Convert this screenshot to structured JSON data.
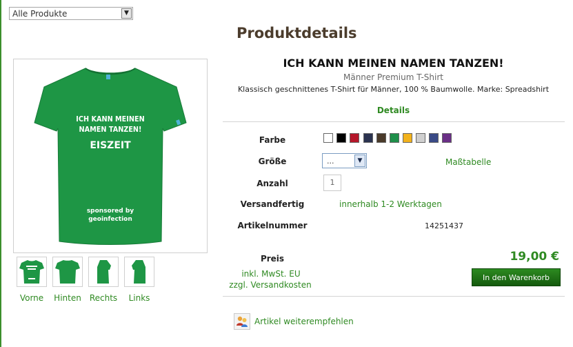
{
  "category_select": {
    "value": "Alle Produkte"
  },
  "page_title": "Produktdetails",
  "product": {
    "title": "ICH KANN MEINEN NAMEN TANZEN!",
    "subtitle": "Männer Premium T-Shirt",
    "description": "Klassisch geschnittenes T-Shirt für Männer, 100 % Baumwolle. Marke: Spreadshirt",
    "shirt_print": {
      "line1": "ICH KANN MEINEN",
      "line2": "NAMEN TANZEN!",
      "line3": "EISZEIT",
      "line4": "sponsored by",
      "line5": "geoinfection"
    }
  },
  "thumbnails": [
    {
      "label": "Vorne"
    },
    {
      "label": "Hinten"
    },
    {
      "label": "Rechts"
    },
    {
      "label": "Links"
    }
  ],
  "details_tab": "Details",
  "attributes": {
    "color_label": "Farbe",
    "colors": [
      "#ffffff",
      "#000000",
      "#b5172a",
      "#2b3350",
      "#4a3a2a",
      "#1f8f4a",
      "#f2b21c",
      "#cfcfcf",
      "#3a4a86",
      "#6a2f86"
    ],
    "size_label": "Größe",
    "size_value": "...",
    "size_chart_link": "Maßtabelle",
    "quantity_label": "Anzahl",
    "quantity_value": "1",
    "shipping_label": "Versandfertig",
    "shipping_value": "innerhalb 1-2 Werktagen",
    "article_label": "Artikelnummer",
    "article_value": "14251437"
  },
  "pricing": {
    "price_label": "Preis",
    "tax_note": "inkl. MwSt. EU",
    "shipping_note": "zzgl. Versandkosten",
    "price": "19,00 €",
    "cart_button": "In den Warenkorb"
  },
  "recommend": {
    "label": "Artikel weiterempfehlen",
    "icon": "people-icon"
  },
  "colors": {
    "accent": "#2f8a22",
    "shirt": "#1e9645",
    "title_brown": "#4b3c2c"
  }
}
